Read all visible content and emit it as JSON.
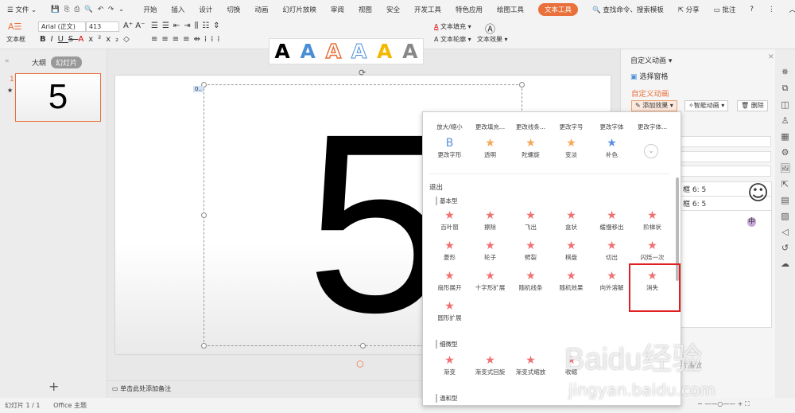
{
  "menubar": {
    "file": "文件",
    "tabs": [
      "开始",
      "插入",
      "设计",
      "切换",
      "动画",
      "幻灯片放映",
      "审阅",
      "视图",
      "安全",
      "开发工具",
      "特色应用",
      "绘图工具"
    ],
    "active_tab": "文本工具",
    "search": "查找命令、搜索模板",
    "share": "分享",
    "comment": "批注",
    "help": "?"
  },
  "ribbon": {
    "textbox": "文本框",
    "font": "Arial (正文)",
    "size": "413",
    "art_letter": "A",
    "fill": "文本填充",
    "outline": "文本轮廓",
    "effect": "文本效果",
    "accent": "#e9703a"
  },
  "left": {
    "outline": "大纲",
    "slides": "幻灯片",
    "slide_num": "1",
    "thumb_text": "5",
    "add": "+"
  },
  "slide": {
    "text": "5",
    "tag": "0.."
  },
  "notes": "单击此处添加备注",
  "status": {
    "slide": "幻灯片 1 / 1",
    "theme": "Office 主题"
  },
  "panel": {
    "title": "自定义动画",
    "select_pane": "选择窗格",
    "section": "自定义动画",
    "add_effect": "添加效果",
    "smart": "智能动画",
    "delete": "删除",
    "items": [
      "框 6: 5",
      "框 6: 5"
    ],
    "play": "片播放"
  },
  "popup": {
    "top_row": [
      "放大/缩小",
      "更改填充...",
      "更改线条...",
      "更改字号",
      "更改字体",
      "更改字体..."
    ],
    "row2": [
      "更改字形",
      "透明",
      "陀螺旋",
      "变淡",
      "补色"
    ],
    "exit": "退出",
    "basic": "基本型",
    "basic_items": [
      "百叶窗",
      "擦除",
      "飞出",
      "盒状",
      "缓慢移出",
      "阶梯状",
      "菱形",
      "轮子",
      "劈裂",
      "棋盘",
      "切出",
      "闪烁一次",
      "扇形展开",
      "十字形扩展",
      "随机线条",
      "随机效果",
      "向外溶解",
      "消失",
      "圆形扩展"
    ],
    "subtle": "细微型",
    "subtle_items": [
      "渐变",
      "渐变式回旋",
      "渐变式缩放",
      "收缩"
    ],
    "moderate": "温和型"
  },
  "watermark": {
    "line1": "Baidu经验",
    "line2": "jingyan.baidu.com"
  }
}
